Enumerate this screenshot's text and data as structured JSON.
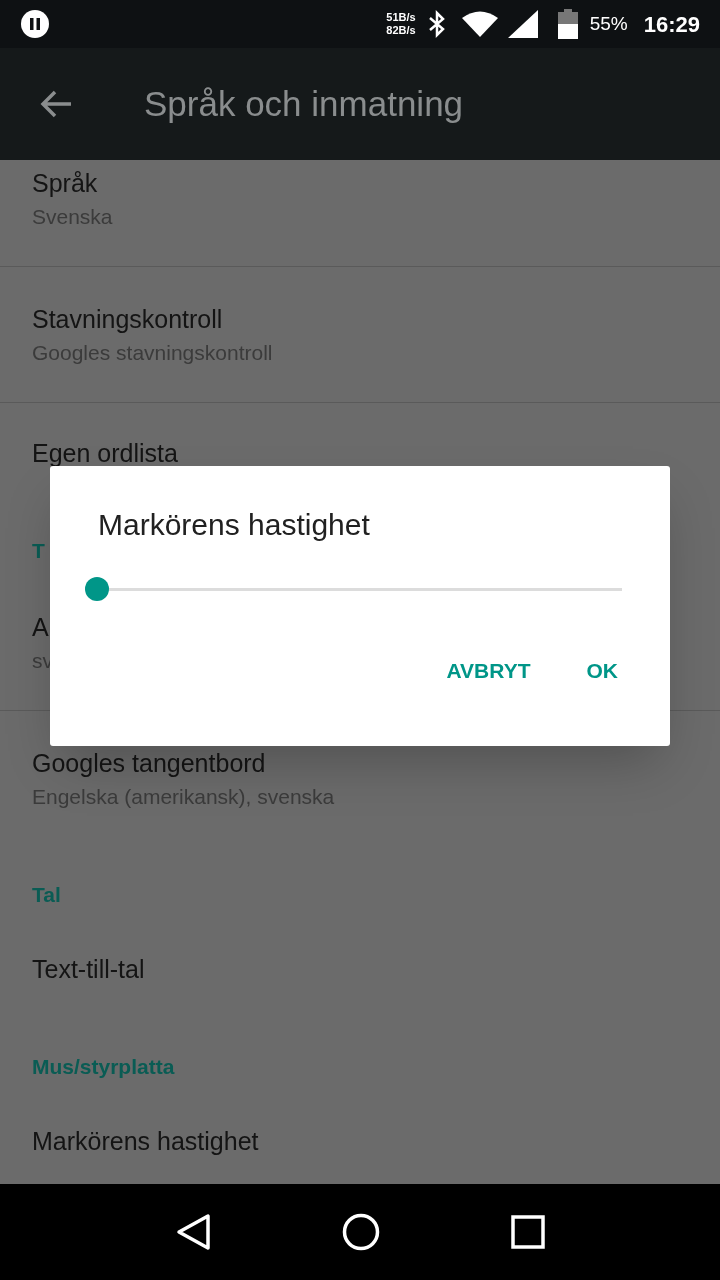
{
  "status_bar": {
    "net_up": "51B/s",
    "net_down": "82B/s",
    "battery": "55%",
    "time": "16:29"
  },
  "toolbar": {
    "title": "Språk och inmatning"
  },
  "list": [
    {
      "kind": "item",
      "title": "Språk",
      "summary": "Svenska"
    },
    {
      "kind": "item",
      "title": "Stavningskontroll",
      "summary": "Googles stavningskontroll"
    },
    {
      "kind": "item",
      "title": "Egen ordlista"
    },
    {
      "kind": "header",
      "title": "T"
    },
    {
      "kind": "item",
      "title": "A",
      "summary": "sv"
    },
    {
      "kind": "item",
      "title": "Googles tangentbord",
      "summary": "Engelska (amerikansk), svenska"
    },
    {
      "kind": "header",
      "title": "Tal"
    },
    {
      "kind": "item",
      "title": "Text-till-tal"
    },
    {
      "kind": "header",
      "title": "Mus/styrplatta"
    },
    {
      "kind": "item",
      "title": "Markörens hastighet"
    }
  ],
  "dialog": {
    "title": "Markörens hastighet",
    "slider": {
      "level": 0
    },
    "buttons": [
      "AVBRYT",
      "OK"
    ]
  }
}
